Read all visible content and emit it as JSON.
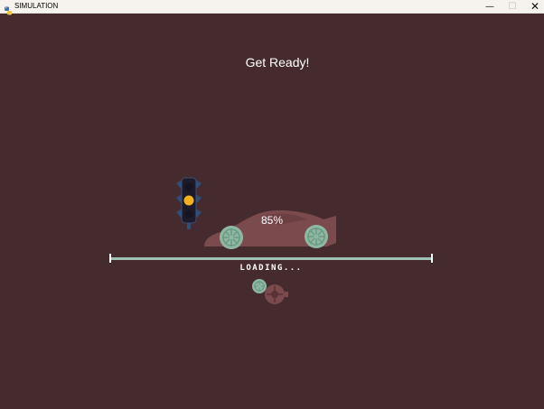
{
  "window": {
    "title": "SIMULATION",
    "icon": "python-icon"
  },
  "controls": {
    "minimize": "—",
    "maximize": "☐",
    "close": "✕"
  },
  "screen": {
    "heading": "Get Ready!",
    "progress_text": "85%",
    "progress": 0.85,
    "loading_text": "LOADING..."
  },
  "colors": {
    "background": "#452b2e",
    "car_body": "#7a4a4d",
    "wheel": "#8fb8a2",
    "bar": "#9ec0b6",
    "traffic_light_body": "#1d1b2a",
    "amber_light": "#f3b21d"
  }
}
